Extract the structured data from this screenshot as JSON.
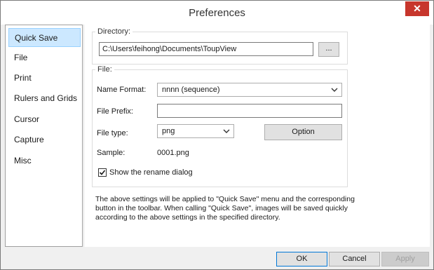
{
  "window": {
    "title": "Preferences",
    "close_glyph": "✕"
  },
  "sidebar": {
    "items": [
      {
        "label": "Quick Save",
        "selected": true
      },
      {
        "label": "File"
      },
      {
        "label": "Print"
      },
      {
        "label": "Rulers and Grids"
      },
      {
        "label": "Cursor"
      },
      {
        "label": "Capture"
      },
      {
        "label": "Misc"
      }
    ]
  },
  "directory": {
    "group_label": "Directory:",
    "path": "C:\\Users\\feihong\\Documents\\ToupView",
    "browse_label": "..."
  },
  "file": {
    "group_label": "File:",
    "name_format_label": "Name Format:",
    "name_format_value": "nnnn (sequence)",
    "prefix_label": "File Prefix:",
    "prefix_value": "",
    "type_label": "File type:",
    "type_value": "png",
    "option_label": "Option",
    "sample_label": "Sample:",
    "sample_value": "0001.png",
    "rename_label": "Show the rename dialog",
    "rename_checked": true
  },
  "note": "The above settings will be applied to \"Quick Save\" menu and the corresponding button in the toolbar. When calling \"Quick Save\", images will be saved quickly according to the above settings in the specified directory.",
  "footer": {
    "ok_label": "OK",
    "cancel_label": "Cancel",
    "apply_label": "Apply"
  },
  "colors": {
    "close_button": "#c7362c",
    "selected_item": "#cce8ff",
    "ok_border": "#0078d7"
  }
}
